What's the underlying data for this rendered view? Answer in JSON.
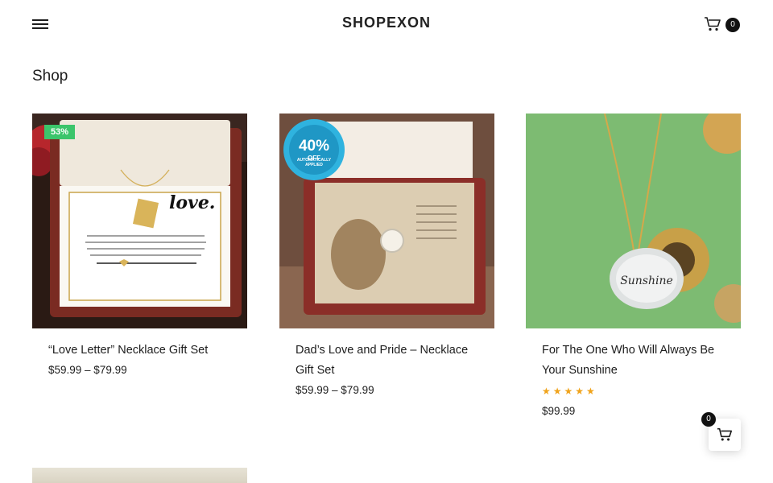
{
  "header": {
    "logo": "SHOPEXON",
    "menu_icon": "hamburger-menu-icon",
    "cart_icon": "shopping-cart-icon",
    "cart_count": "0"
  },
  "page": {
    "title": "Shop"
  },
  "products": [
    {
      "name": "“Love Letter” Necklace Gift Set",
      "price": "$59.99 – $79.99",
      "badge": "53%"
    },
    {
      "name": "Dad’s Love and Pride – Necklace Gift Set",
      "price": "$59.99 – $79.99",
      "promo_percent": "40%",
      "promo_off": "OFF",
      "promo_note": "AUTOMATICALLY APPLIED"
    },
    {
      "name": "For The One Who Will Always Be Your Sunshine",
      "price": "$99.99",
      "rating": 5,
      "rating_stars": "★★★★★"
    }
  ],
  "floating_cart": {
    "count": "0",
    "icon": "shopping-cart-icon"
  },
  "colors": {
    "sale_badge": "#3bc56b",
    "stars": "#f0a31b",
    "text": "#1d1d1d",
    "badge_dark": "#111111"
  }
}
